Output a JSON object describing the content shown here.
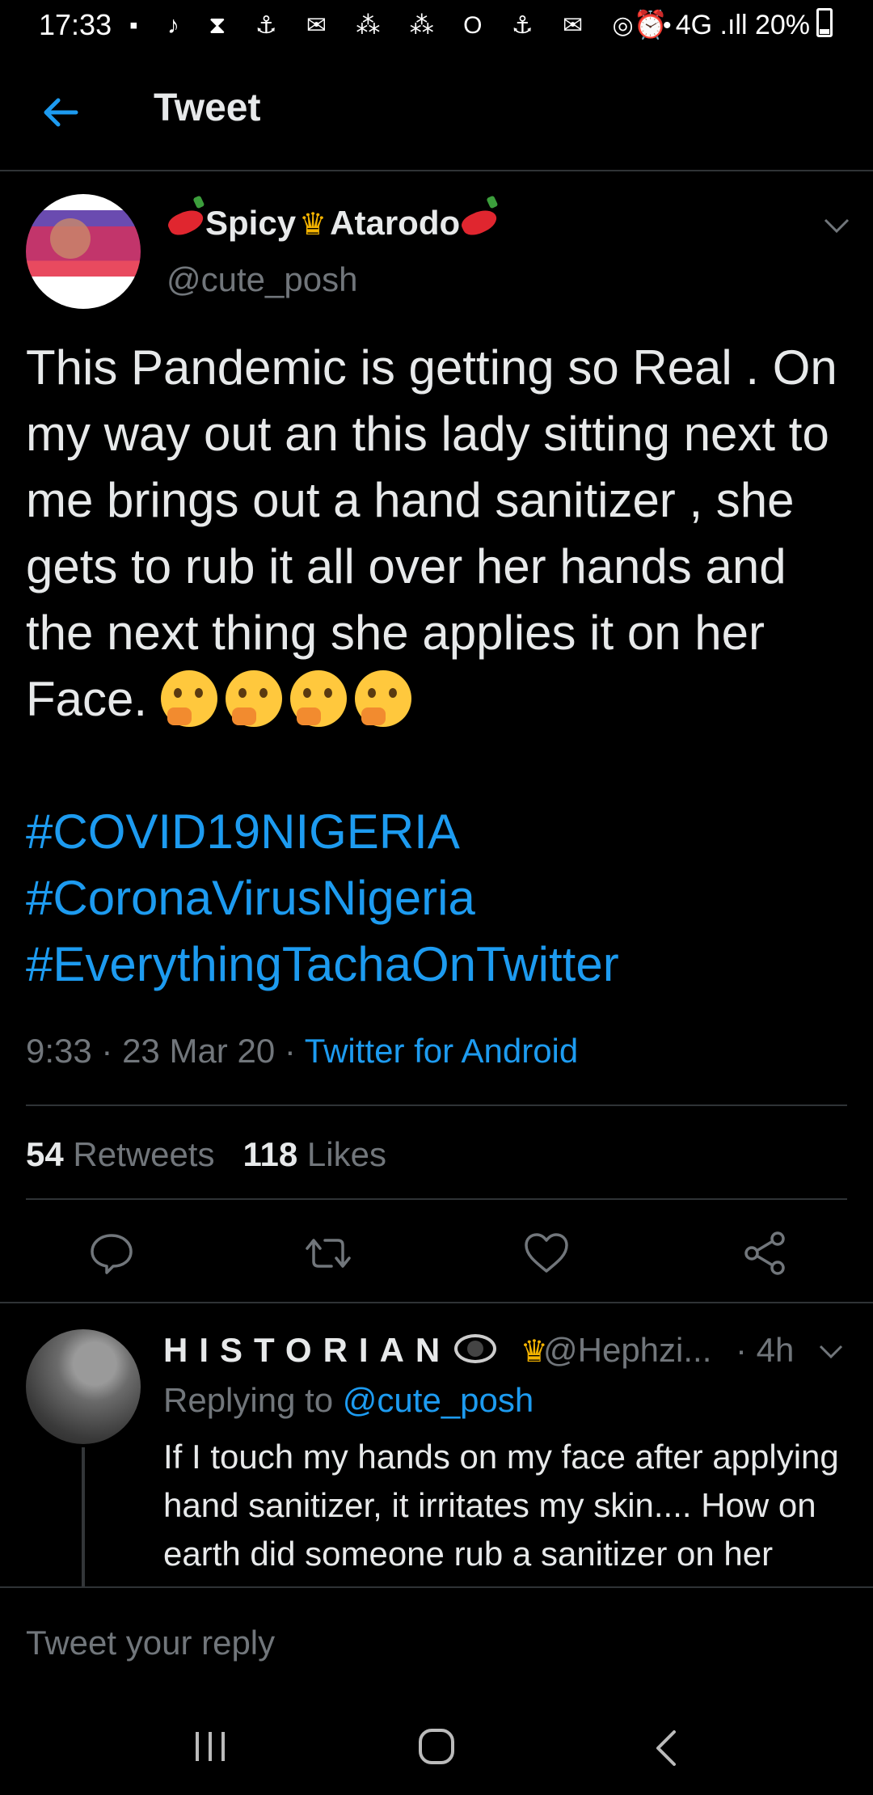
{
  "status_bar": {
    "time": "17:33",
    "notification_icons": "▪ ♪ ⧗ ⚓ ✉ ⁂ ⁂ O ⚓ ✉ ◎ •",
    "right_text": "⏰ 4G .ıll 20%"
  },
  "header": {
    "title": "Tweet"
  },
  "tweet": {
    "display_name_left": "Spicy",
    "display_name_right": "Atarodo",
    "handle": "@cute_posh",
    "text": "This Pandemic is getting so Real . On my way out an this lady sitting next to me brings out a hand sanitizer , she gets to rub it all over her hands and the next thing she applies it on her Face.",
    "hashtags": [
      "#COVID19NIGERIA",
      "#CoronaVirusNigeria",
      "#EverythingTachaOnTwitter"
    ],
    "time": "9:33",
    "date": "23 Mar 20",
    "source": "Twitter for Android",
    "retweets_count": "54",
    "retweets_label": "Retweets",
    "likes_count": "118",
    "likes_label": "Likes"
  },
  "reply": {
    "name": "HISTORIAN",
    "handle": "@Hephzi...",
    "time": "· 4h",
    "replying_prefix": "Replying to",
    "replying_to": "@cute_posh",
    "text": "If I touch my hands on my face after applying hand sanitizer, it irritates my skin.... How on earth did someone rub a sanitizer on her face?"
  },
  "composer": {
    "placeholder": "Tweet your reply"
  },
  "colors": {
    "accent": "#1d9bf0",
    "background": "#000000",
    "muted": "#71767b",
    "text": "#e7e9ea"
  }
}
